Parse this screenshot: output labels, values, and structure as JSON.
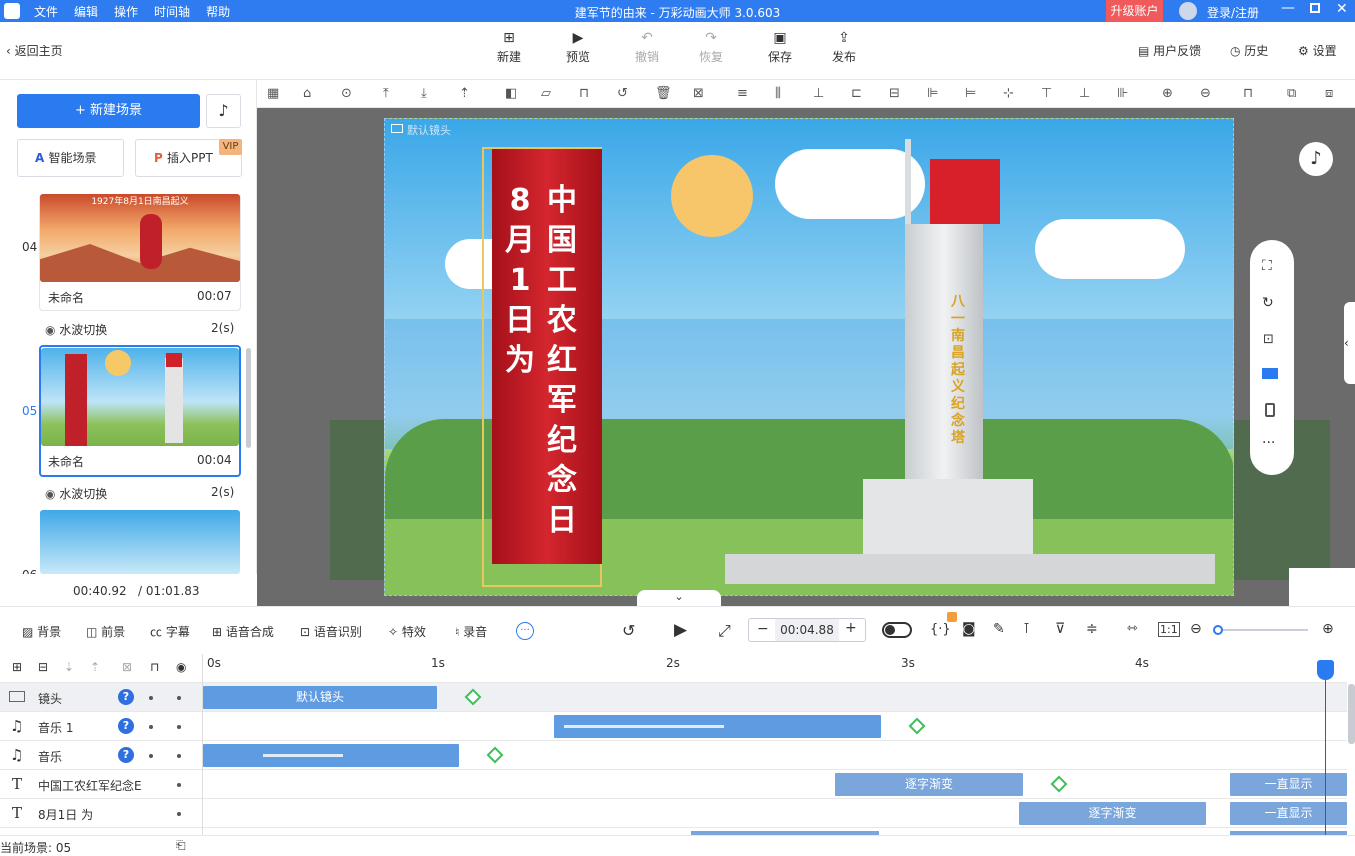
{
  "titlebar": {
    "menus": [
      "文件",
      "编辑",
      "操作",
      "时间轴",
      "帮助"
    ],
    "title": "建军节的由来 - 万彩动画大师 3.0.603",
    "upgrade": "升级账户",
    "login": "登录/注册"
  },
  "toolbar": {
    "back": "返回主页",
    "new": "新建",
    "preview": "预览",
    "undo": "撤销",
    "redo": "恢复",
    "save": "保存",
    "publish": "发布",
    "feedback": "用户反馈",
    "history": "历史",
    "settings": "设置"
  },
  "left": {
    "new_scene": "+ 新建场景",
    "smart_scene": "智能场景",
    "insert_ppt": "插入PPT",
    "vip": "VIP",
    "scenes": [
      {
        "num": "04",
        "name": "未命名",
        "time": "00:07",
        "transition": "水波切换",
        "trans_time": "2(s)",
        "thumb_text": "1927年8月1日南昌起义"
      },
      {
        "num": "05",
        "name": "未命名",
        "time": "00:04",
        "transition": "水波切换",
        "trans_time": "2(s)"
      },
      {
        "num": "06"
      }
    ],
    "time_current": "00:40.92",
    "time_total": "/ 01:01.83"
  },
  "canvas": {
    "camera_label": "默认镜头",
    "banner_left": "8月1日为",
    "banner_right": "中国工农红军纪念日",
    "monument_text": "八一南昌起义纪念塔"
  },
  "bottom": {
    "bg": "背景",
    "fg": "前景",
    "subtitle": "字幕",
    "tts": "语音合成",
    "asr": "语音识别",
    "effects": "特效",
    "record": "录音",
    "time": "00:04.88",
    "scale": "1:1"
  },
  "timeline": {
    "ticks": [
      "0s",
      "1s",
      "2s",
      "3s",
      "4s"
    ],
    "tracks": [
      {
        "name": "镜头",
        "clips": [
          {
            "label": "默认镜头"
          }
        ]
      },
      {
        "name": "音乐 1"
      },
      {
        "name": "音乐"
      },
      {
        "name": "中国工农红军纪念E",
        "clips": [
          {
            "label": "逐字渐变"
          },
          {
            "label": "一直显示"
          }
        ]
      },
      {
        "name": "8月1日 为",
        "clips": [
          {
            "label": "逐字渐变"
          },
          {
            "label": "一直显示"
          }
        ]
      }
    ],
    "status": "当前场景: 05"
  }
}
